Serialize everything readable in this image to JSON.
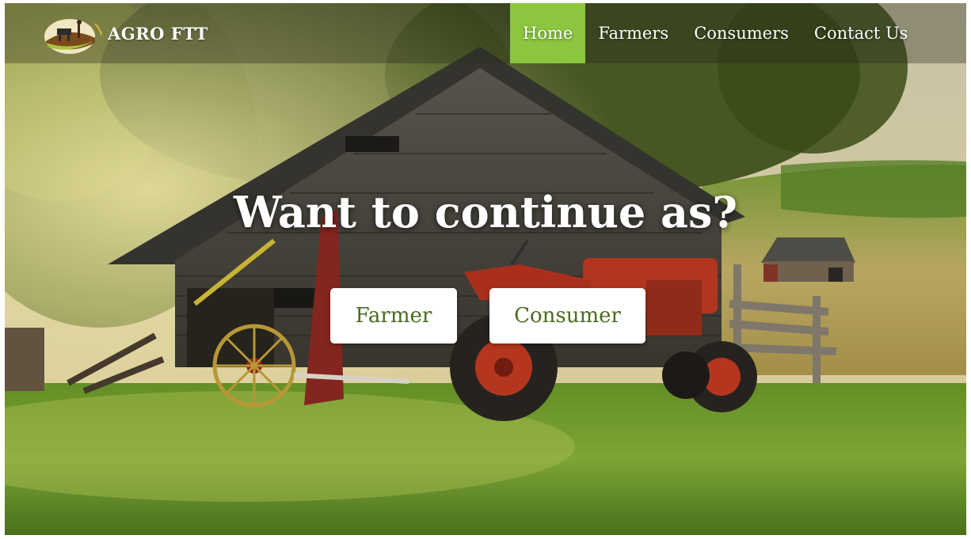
{
  "brand": {
    "name": "AGRO FTT",
    "logo_icon": "farm-logo-icon"
  },
  "nav": {
    "items": [
      {
        "label": "Home",
        "active": true
      },
      {
        "label": "Farmers",
        "active": false
      },
      {
        "label": "Consumers",
        "active": false
      },
      {
        "label": "Contact Us",
        "active": false
      }
    ]
  },
  "hero": {
    "title": "Want to continue as?",
    "buttons": {
      "farmer": "Farmer",
      "consumer": "Consumer"
    },
    "background_image": "farm-barn-tractor-photo"
  },
  "colors": {
    "accent": "#8cc63f",
    "button_text": "#4a6b22"
  }
}
